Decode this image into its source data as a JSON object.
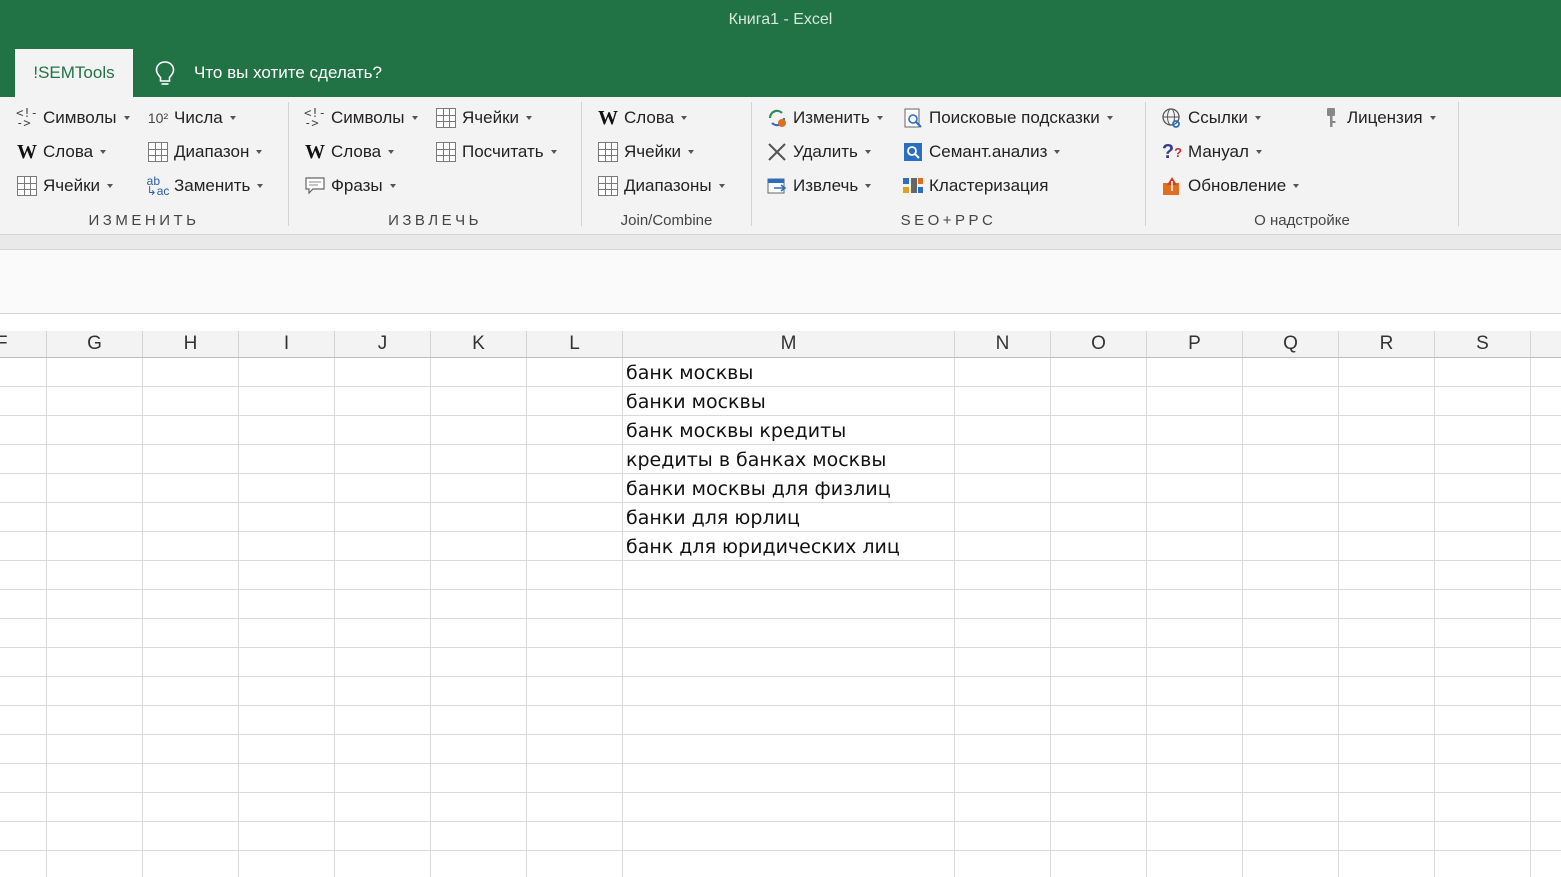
{
  "window": {
    "title": "Книга1  -  Excel"
  },
  "tabs": {
    "active": "!SEMTools",
    "tell_me": "Что вы хотите сделать?"
  },
  "ribbon": {
    "groups": [
      {
        "title": "ИЗМЕНИТЬ",
        "buttons": [
          "Символы",
          "Числа",
          "Слова",
          "Диапазон",
          "Ячейки",
          "Заменить"
        ]
      },
      {
        "title": "ИЗВЛЕЧЬ",
        "buttons": [
          "Символы",
          "Ячейки",
          "Слова",
          "Посчитать",
          "Фразы"
        ]
      },
      {
        "title": "Join/Combine",
        "buttons": [
          "Слова",
          "Ячейки",
          "Диапазоны"
        ]
      },
      {
        "title": "SEO+PPC",
        "buttons": [
          "Изменить",
          "Поисковые подсказки",
          "Удалить",
          "Семант.анализ",
          "Извлечь",
          "Кластеризация"
        ]
      },
      {
        "title": "О надстройке",
        "buttons": [
          "Ссылки",
          "Лицензия",
          "Мануал",
          "Обновление"
        ]
      }
    ],
    "numbers_icon_text": "10²"
  },
  "sheet": {
    "partial_left_col": "F",
    "columns": [
      "G",
      "H",
      "I",
      "J",
      "K",
      "L",
      "M",
      "N",
      "O",
      "P",
      "Q",
      "R",
      "S"
    ],
    "column_M_values": [
      "банк москвы",
      "банки москвы",
      "банк москвы кредиты",
      "кредиты в банках москвы",
      "банки москвы для физлиц",
      "банки для юрлиц",
      "банк для юридических лиц"
    ]
  },
  "icons": {
    "tell_me": "lightbulb-icon",
    "symbols": "symbols-icon",
    "words": "word-w-icon",
    "cells": "grid-icon",
    "replace": "abc-replace-icon",
    "phrases": "speech-bubble-icon",
    "modify": "refresh-gear-icon",
    "suggest": "search-doc-icon",
    "delete": "x-icon",
    "semantic": "magnifier-doc-icon",
    "extract": "extract-icon",
    "cluster": "cluster-icon",
    "links": "globe-link-icon",
    "license": "key-icon",
    "manual": "question-icon",
    "update": "update-icon"
  },
  "colors": {
    "titlebar": "#217346",
    "ribbon": "#f3f3f3"
  }
}
